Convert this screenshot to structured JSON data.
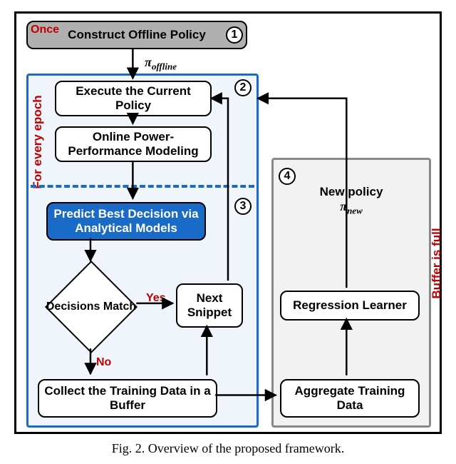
{
  "caption": "Fig. 2.  Overview of the proposed framework.",
  "tags": {
    "once": "Once",
    "for_every_epoch": "For every epoch",
    "buffer_full": "Buffer is full",
    "yes": "Yes",
    "no": "No"
  },
  "symbols": {
    "pi_offline_pi": "π",
    "pi_offline_sub": "offline",
    "pi_new_pi": "π",
    "pi_new_sub": "new"
  },
  "nodes": {
    "step1": "Construct Offline  Policy",
    "step2a": "Execute the Current Policy",
    "step2b": "Online Power-Performance Modeling",
    "step3a": "Predict Best Decision via Analytical Models",
    "decision": "Decisions Match",
    "next_snippet": "Next Snippet",
    "collect": "Collect the Training Data in a Buffer",
    "aggregate": "Aggregate Training Data",
    "regression": "Regression Learner",
    "step4_text": "New policy"
  },
  "circles": {
    "c1": "1",
    "c2": "2",
    "c3": "3",
    "c4": "4"
  },
  "chart_data": {
    "type": "diagram",
    "title": "Overview of the proposed framework",
    "regions": [
      {
        "id": 1,
        "label": "Once",
        "nodes": [
          "Construct Offline Policy"
        ]
      },
      {
        "id": 2,
        "label": "For every epoch (upper)",
        "nodes": [
          "Execute the Current Policy",
          "Online Power-Performance Modeling"
        ]
      },
      {
        "id": 3,
        "label": "For every epoch (lower)",
        "nodes": [
          "Predict Best Decision via Analytical Models",
          "Decisions Match",
          "Next Snippet",
          "Collect the Training Data in a Buffer"
        ]
      },
      {
        "id": 4,
        "label": "Buffer is full",
        "nodes": [
          "New policy π_new",
          "Regression Learner",
          "Aggregate Training Data"
        ]
      }
    ],
    "edges": [
      {
        "from": "Construct Offline Policy",
        "to": "Execute the Current Policy",
        "label": "π_offline"
      },
      {
        "from": "Execute the Current Policy",
        "to": "Online Power-Performance Modeling",
        "label": ""
      },
      {
        "from": "Online Power-Performance Modeling",
        "to": "Predict Best Decision via Analytical Models",
        "label": ""
      },
      {
        "from": "Predict Best Decision via Analytical Models",
        "to": "Decisions Match",
        "label": ""
      },
      {
        "from": "Decisions Match",
        "to": "Next Snippet",
        "label": "Yes"
      },
      {
        "from": "Decisions Match",
        "to": "Collect the Training Data in a Buffer",
        "label": "No"
      },
      {
        "from": "Collect the Training Data in a Buffer",
        "to": "Next Snippet",
        "label": ""
      },
      {
        "from": "Next Snippet",
        "to": "Execute the Current Policy",
        "label": ""
      },
      {
        "from": "Collect the Training Data in a Buffer",
        "to": "Aggregate Training Data",
        "label": ""
      },
      {
        "from": "Aggregate Training Data",
        "to": "Regression Learner",
        "label": ""
      },
      {
        "from": "Regression Learner",
        "to": "Execute the Current Policy",
        "label": "New policy π_new (Buffer is full)"
      }
    ]
  }
}
